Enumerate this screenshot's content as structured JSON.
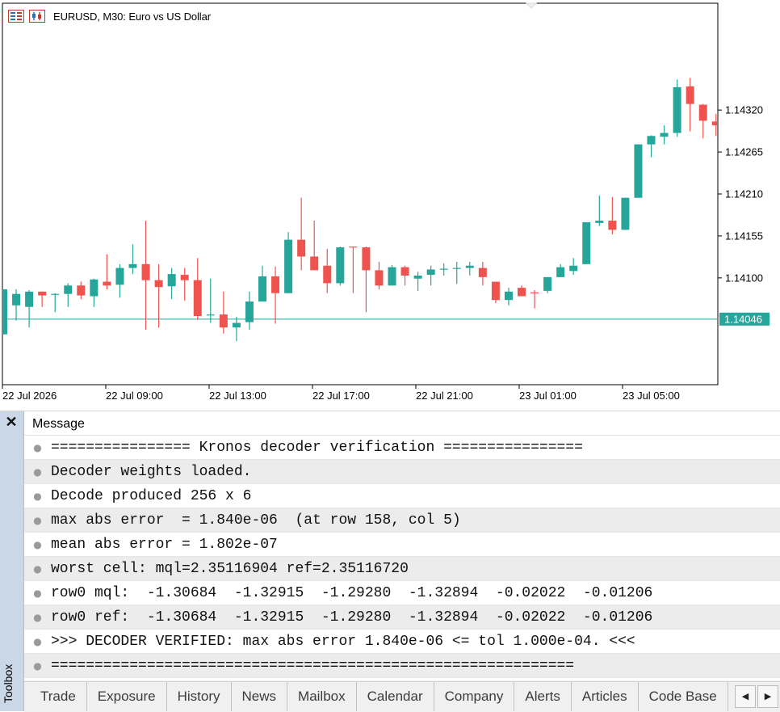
{
  "window": {
    "title": "EURUSD, M30:  Euro vs US Dollar"
  },
  "chart_data": {
    "type": "candlestick",
    "title": "EURUSD, M30:  Euro vs US Dollar",
    "ylim": [
      1.1396,
      1.1446
    ],
    "y_ticks": [
      "1.14320",
      "1.14265",
      "1.14210",
      "1.14155",
      "1.14100"
    ],
    "x_ticks": [
      "22 Jul 2026",
      "22 Jul 09:00",
      "22 Jul 13:00",
      "22 Jul 17:00",
      "22 Jul 21:00",
      "23 Jul 01:00",
      "23 Jul 05:00"
    ],
    "current_price": "1.14046",
    "current_price_value": 1.14046,
    "candles": [
      {
        "o": 1.14026,
        "h": 1.14085,
        "l": 1.14026,
        "c": 1.14085
      },
      {
        "o": 1.14064,
        "h": 1.14085,
        "l": 1.14044,
        "c": 1.14079
      },
      {
        "o": 1.14062,
        "h": 1.14084,
        "l": 1.14035,
        "c": 1.14082
      },
      {
        "o": 1.14082,
        "h": 1.14082,
        "l": 1.14062,
        "c": 1.14077
      },
      {
        "o": 1.14079,
        "h": 1.1408,
        "l": 1.14055,
        "c": 1.14079
      },
      {
        "o": 1.14079,
        "h": 1.14093,
        "l": 1.14062,
        "c": 1.1409
      },
      {
        "o": 1.1409,
        "h": 1.14095,
        "l": 1.14072,
        "c": 1.14077
      },
      {
        "o": 1.14076,
        "h": 1.14099,
        "l": 1.14062,
        "c": 1.14098
      },
      {
        "o": 1.14095,
        "h": 1.14131,
        "l": 1.14085,
        "c": 1.1409
      },
      {
        "o": 1.14091,
        "h": 1.14118,
        "l": 1.14074,
        "c": 1.14113
      },
      {
        "o": 1.14113,
        "h": 1.14144,
        "l": 1.14105,
        "c": 1.14118
      },
      {
        "o": 1.14118,
        "h": 1.14175,
        "l": 1.14032,
        "c": 1.14097
      },
      {
        "o": 1.14097,
        "h": 1.14118,
        "l": 1.14035,
        "c": 1.14088
      },
      {
        "o": 1.14089,
        "h": 1.14113,
        "l": 1.14072,
        "c": 1.14105
      },
      {
        "o": 1.14104,
        "h": 1.14113,
        "l": 1.1407,
        "c": 1.14097
      },
      {
        "o": 1.14097,
        "h": 1.14126,
        "l": 1.14045,
        "c": 1.1405
      },
      {
        "o": 1.14052,
        "h": 1.14099,
        "l": 1.14041,
        "c": 1.14052
      },
      {
        "o": 1.14052,
        "h": 1.14082,
        "l": 1.14027,
        "c": 1.14035
      },
      {
        "o": 1.14035,
        "h": 1.14049,
        "l": 1.14017,
        "c": 1.14041
      },
      {
        "o": 1.14042,
        "h": 1.14082,
        "l": 1.14032,
        "c": 1.14069
      },
      {
        "o": 1.14069,
        "h": 1.14116,
        "l": 1.14069,
        "c": 1.14102
      },
      {
        "o": 1.14102,
        "h": 1.14115,
        "l": 1.1404,
        "c": 1.1408
      },
      {
        "o": 1.1408,
        "h": 1.1416,
        "l": 1.1408,
        "c": 1.1415
      },
      {
        "o": 1.1415,
        "h": 1.14205,
        "l": 1.1411,
        "c": 1.14128
      },
      {
        "o": 1.14128,
        "h": 1.14175,
        "l": 1.14115,
        "c": 1.1411
      },
      {
        "o": 1.14116,
        "h": 1.14138,
        "l": 1.1408,
        "c": 1.14093
      },
      {
        "o": 1.14093,
        "h": 1.14141,
        "l": 1.1409,
        "c": 1.1414
      },
      {
        "o": 1.14141,
        "h": 1.1414,
        "l": 1.1408,
        "c": 1.1414
      },
      {
        "o": 1.1414,
        "h": 1.14141,
        "l": 1.14055,
        "c": 1.1411
      },
      {
        "o": 1.1411,
        "h": 1.14121,
        "l": 1.14085,
        "c": 1.1409
      },
      {
        "o": 1.1409,
        "h": 1.14117,
        "l": 1.1409,
        "c": 1.14114
      },
      {
        "o": 1.14114,
        "h": 1.14116,
        "l": 1.1409,
        "c": 1.14103
      },
      {
        "o": 1.14099,
        "h": 1.14108,
        "l": 1.14083,
        "c": 1.14103
      },
      {
        "o": 1.14104,
        "h": 1.14116,
        "l": 1.1409,
        "c": 1.14111
      },
      {
        "o": 1.14112,
        "h": 1.14119,
        "l": 1.14103,
        "c": 1.14112
      },
      {
        "o": 1.14112,
        "h": 1.14121,
        "l": 1.14092,
        "c": 1.14113
      },
      {
        "o": 1.14113,
        "h": 1.14121,
        "l": 1.14103,
        "c": 1.14116
      },
      {
        "o": 1.14113,
        "h": 1.14121,
        "l": 1.1409,
        "c": 1.14101
      },
      {
        "o": 1.14095,
        "h": 1.14094,
        "l": 1.14067,
        "c": 1.14071
      },
      {
        "o": 1.14071,
        "h": 1.14087,
        "l": 1.14064,
        "c": 1.14082
      },
      {
        "o": 1.14087,
        "h": 1.1409,
        "l": 1.14078,
        "c": 1.14076
      },
      {
        "o": 1.14081,
        "h": 1.14084,
        "l": 1.1406,
        "c": 1.1408
      },
      {
        "o": 1.14083,
        "h": 1.14101,
        "l": 1.1408,
        "c": 1.14101
      },
      {
        "o": 1.14101,
        "h": 1.14118,
        "l": 1.14101,
        "c": 1.14114
      },
      {
        "o": 1.14109,
        "h": 1.14126,
        "l": 1.14104,
        "c": 1.14116
      },
      {
        "o": 1.14118,
        "h": 1.1417,
        "l": 1.14118,
        "c": 1.14173
      },
      {
        "o": 1.14172,
        "h": 1.14208,
        "l": 1.14168,
        "c": 1.14175
      },
      {
        "o": 1.14175,
        "h": 1.14206,
        "l": 1.14157,
        "c": 1.14163
      },
      {
        "o": 1.14163,
        "h": 1.14205,
        "l": 1.14163,
        "c": 1.14205
      },
      {
        "o": 1.14205,
        "h": 1.14275,
        "l": 1.14205,
        "c": 1.14275
      },
      {
        "o": 1.14275,
        "h": 1.14287,
        "l": 1.14258,
        "c": 1.14286
      },
      {
        "o": 1.14285,
        "h": 1.143,
        "l": 1.14275,
        "c": 1.1429
      },
      {
        "o": 1.1429,
        "h": 1.1436,
        "l": 1.14285,
        "c": 1.1435
      },
      {
        "o": 1.14351,
        "h": 1.14362,
        "l": 1.14292,
        "c": 1.14328
      },
      {
        "o": 1.14327,
        "h": 1.14328,
        "l": 1.14283,
        "c": 1.14306
      },
      {
        "o": 1.14305,
        "h": 1.14315,
        "l": 1.14286,
        "c": 1.143
      }
    ]
  },
  "colors": {
    "bull": "#26a69a",
    "bear": "#ef5350",
    "price_tag": "#26a69a"
  },
  "journal": {
    "column_header": "Message",
    "rows": [
      "================ Kronos decoder verification ================",
      "Decoder weights loaded.",
      "Decode produced 256 x 6",
      "max abs error  = 1.840e-06  (at row 158, col 5)",
      "mean abs error = 1.802e-07",
      "worst cell: mql=2.35116904 ref=2.35116720",
      "row0 mql:  -1.30684  -1.32915  -1.29280  -1.32894  -0.02022  -0.01206",
      "row0 ref:  -1.30684  -1.32915  -1.29280  -1.32894  -0.02022  -0.01206",
      ">>> DECODER VERIFIED: max abs error 1.840e-06 <= tol 1.000e-04. <<<",
      "============================================================"
    ]
  },
  "toolbox": {
    "label": "Toolbox",
    "close_glyph": "✕",
    "tabs": [
      "Trade",
      "Exposure",
      "History",
      "News",
      "Mailbox",
      "Calendar",
      "Company",
      "Alerts",
      "Articles",
      "Code Base"
    ],
    "scroll_left_glyph": "◀",
    "scroll_right_glyph": "▶"
  }
}
